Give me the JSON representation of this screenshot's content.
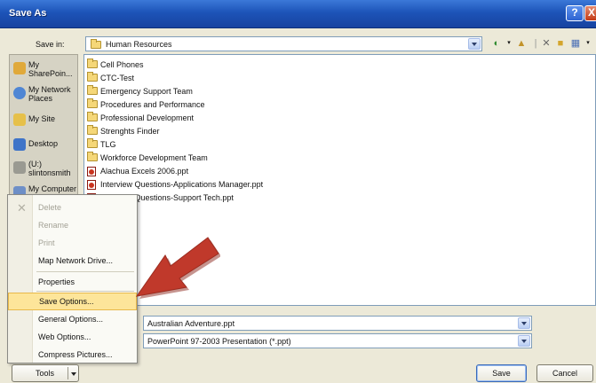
{
  "window": {
    "title": "Save As",
    "help": "?",
    "close": "X"
  },
  "header": {
    "save_in_label": "Save in:",
    "current_folder": "Human Resources"
  },
  "places": [
    {
      "label": "My SharePoin...",
      "icon": "sharepoint-icon"
    },
    {
      "label": "My Network Places",
      "icon": "network-places-icon"
    },
    {
      "label": "My Site",
      "icon": "my-site-icon"
    },
    {
      "label": "Desktop",
      "icon": "desktop-icon"
    },
    {
      "label": "(U:) slintonsmith",
      "icon": "drive-icon"
    },
    {
      "label": "My Computer",
      "icon": "computer-icon"
    }
  ],
  "files": [
    {
      "name": "Cell Phones",
      "type": "folder"
    },
    {
      "name": "CTC-Test",
      "type": "folder"
    },
    {
      "name": "Emergency Support Team",
      "type": "folder"
    },
    {
      "name": "Procedures and Performance",
      "type": "folder"
    },
    {
      "name": "Professional Development",
      "type": "folder"
    },
    {
      "name": "Strenghts Finder",
      "type": "folder"
    },
    {
      "name": "TLG",
      "type": "folder"
    },
    {
      "name": "Workforce Development Team",
      "type": "folder"
    },
    {
      "name": "Alachua Excels 2006.ppt",
      "type": "ppt"
    },
    {
      "name": "Interview Questions-Applications Manager.ppt",
      "type": "ppt"
    },
    {
      "name": "Interview Questions-Support Tech.ppt",
      "type": "ppt"
    }
  ],
  "tools_menu": {
    "items": [
      {
        "label": "Delete",
        "enabled": false
      },
      {
        "label": "Rename",
        "enabled": false
      },
      {
        "label": "Print",
        "enabled": false
      },
      {
        "label": "Map Network Drive...",
        "enabled": true
      },
      {
        "label": "Properties",
        "enabled": true
      },
      {
        "label": "Save Options...",
        "enabled": true,
        "highlighted": true
      },
      {
        "label": "General Options...",
        "enabled": true
      },
      {
        "label": "Web Options...",
        "enabled": true
      },
      {
        "label": "Compress Pictures...",
        "enabled": true
      }
    ]
  },
  "footer": {
    "file_name_value": "Australian Adventure.ppt",
    "save_as_type_value": "PowerPoint 97-2003 Presentation (*.ppt)",
    "tools_label": "Tools",
    "save_label": "Save",
    "cancel_label": "Cancel"
  },
  "colors": {
    "title_bar": "#1d54b8",
    "highlight": "#fde59a",
    "arrow": "#c0392b"
  }
}
